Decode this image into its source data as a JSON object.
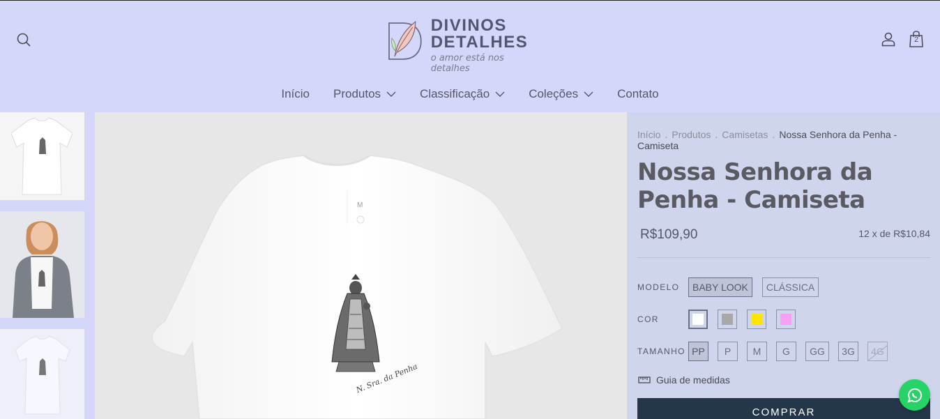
{
  "header": {
    "logo": {
      "line1": "DIVINOS",
      "line2": "DETALHES",
      "tagline": "o amor está nos detalhes"
    },
    "cart_count": "2",
    "icons": [
      "search-icon",
      "user-icon",
      "shopping-bag-icon"
    ]
  },
  "nav": {
    "items": [
      {
        "label": "Início",
        "has_dropdown": false
      },
      {
        "label": "Produtos",
        "has_dropdown": true
      },
      {
        "label": "Classificação",
        "has_dropdown": true
      },
      {
        "label": "Coleções",
        "has_dropdown": true
      },
      {
        "label": "Contato",
        "has_dropdown": false
      }
    ]
  },
  "gallery": {
    "main_image_text": {
      "tag_size": "M",
      "signature": "N. Sra. da Penha"
    }
  },
  "product": {
    "breadcrumb": [
      "Início",
      "Produtos",
      "Camisetas",
      "Nossa Senhora da Penha - Camiseta"
    ],
    "title": "Nossa Senhora da Penha - Camiseta",
    "price": "R$109,90",
    "installments": "12 x de R$10,84",
    "options": {
      "modelo": {
        "label": "MODELO",
        "values": [
          "BABY LOOK",
          "CLÁSSICA"
        ],
        "selected": "BABY LOOK"
      },
      "cor": {
        "label": "COR",
        "swatches": [
          "#ffffff",
          "#a8a8a8",
          "#ffe600",
          "#f5a0f0"
        ],
        "selected_index": 0
      },
      "tamanho": {
        "label": "TAMANHO",
        "values": [
          "PP",
          "P",
          "M",
          "G",
          "GG",
          "3G",
          "4G"
        ],
        "selected": "PP",
        "unavailable": [
          "4G"
        ]
      }
    },
    "size_guide": "Guia de medidas",
    "buy_label": "COMPRAR"
  },
  "colors": {
    "header_bg": "#d4d6fa",
    "panel_bg": "#cfd5ec",
    "buy_button": "#24374a",
    "whatsapp": "#25d366"
  }
}
